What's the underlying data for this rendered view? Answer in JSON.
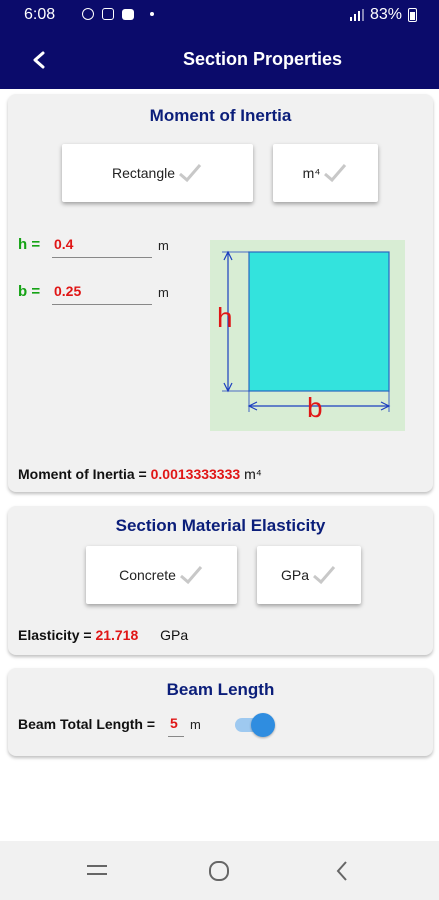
{
  "status": {
    "time": "6:08",
    "battery": "83%"
  },
  "appbar": {
    "title": "Section Properties"
  },
  "moment": {
    "title": "Moment of Inertia",
    "shape_button": "Rectangle",
    "unit_button": "m⁴",
    "h_label": "h =",
    "h_value": "0.4",
    "h_unit": "m",
    "b_label": "b =",
    "b_value": "0.25",
    "b_unit": "m",
    "diagram_h": "h",
    "diagram_b": "b",
    "result_label": "Moment of Inertia =",
    "result_value": "0.0013333333",
    "result_unit": "m⁴"
  },
  "material": {
    "title": "Section Material Elasticity",
    "material_button": "Concrete",
    "unit_button": "GPa",
    "result_label": "Elasticity =",
    "result_value": "21.718",
    "result_unit": "GPa"
  },
  "beam": {
    "title": "Beam Length",
    "label": "Beam Total Length =",
    "value": "5",
    "unit": "m",
    "toggle_on": true
  },
  "colors": {
    "appbar": "#0b0b6b",
    "accent_blue": "#0b1e7a",
    "red": "#e01616",
    "green": "#16a316",
    "section_fill": "#33e3dd",
    "toggle": "#2f8de0"
  },
  "icons": [
    "back-arrow-icon",
    "check-icon",
    "menu-icon",
    "home-icon",
    "back-nav-icon"
  ]
}
